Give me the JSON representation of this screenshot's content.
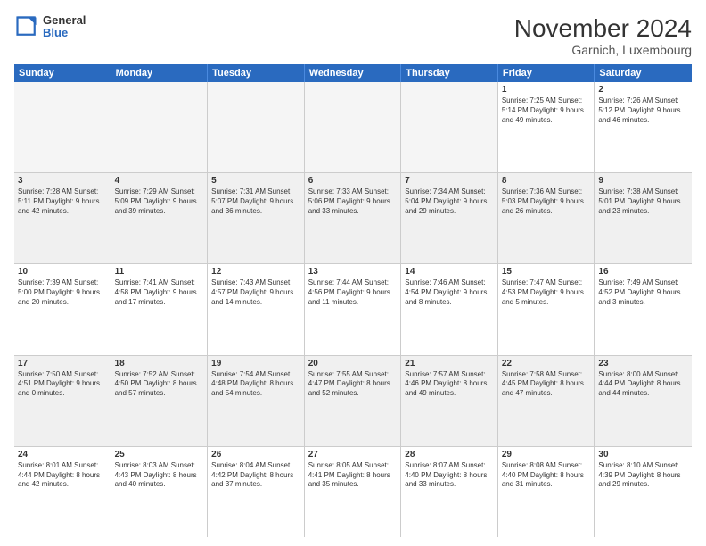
{
  "header": {
    "logo_general": "General",
    "logo_blue": "Blue",
    "title": "November 2024",
    "subtitle": "Garnich, Luxembourg"
  },
  "days": [
    "Sunday",
    "Monday",
    "Tuesday",
    "Wednesday",
    "Thursday",
    "Friday",
    "Saturday"
  ],
  "rows": [
    [
      {
        "day": "",
        "empty": true
      },
      {
        "day": "",
        "empty": true
      },
      {
        "day": "",
        "empty": true
      },
      {
        "day": "",
        "empty": true
      },
      {
        "day": "",
        "empty": true
      },
      {
        "day": "1",
        "info": "Sunrise: 7:25 AM\nSunset: 5:14 PM\nDaylight: 9 hours\nand 49 minutes."
      },
      {
        "day": "2",
        "info": "Sunrise: 7:26 AM\nSunset: 5:12 PM\nDaylight: 9 hours\nand 46 minutes."
      }
    ],
    [
      {
        "day": "3",
        "info": "Sunrise: 7:28 AM\nSunset: 5:11 PM\nDaylight: 9 hours\nand 42 minutes."
      },
      {
        "day": "4",
        "info": "Sunrise: 7:29 AM\nSunset: 5:09 PM\nDaylight: 9 hours\nand 39 minutes."
      },
      {
        "day": "5",
        "info": "Sunrise: 7:31 AM\nSunset: 5:07 PM\nDaylight: 9 hours\nand 36 minutes."
      },
      {
        "day": "6",
        "info": "Sunrise: 7:33 AM\nSunset: 5:06 PM\nDaylight: 9 hours\nand 33 minutes."
      },
      {
        "day": "7",
        "info": "Sunrise: 7:34 AM\nSunset: 5:04 PM\nDaylight: 9 hours\nand 29 minutes."
      },
      {
        "day": "8",
        "info": "Sunrise: 7:36 AM\nSunset: 5:03 PM\nDaylight: 9 hours\nand 26 minutes."
      },
      {
        "day": "9",
        "info": "Sunrise: 7:38 AM\nSunset: 5:01 PM\nDaylight: 9 hours\nand 23 minutes."
      }
    ],
    [
      {
        "day": "10",
        "info": "Sunrise: 7:39 AM\nSunset: 5:00 PM\nDaylight: 9 hours\nand 20 minutes."
      },
      {
        "day": "11",
        "info": "Sunrise: 7:41 AM\nSunset: 4:58 PM\nDaylight: 9 hours\nand 17 minutes."
      },
      {
        "day": "12",
        "info": "Sunrise: 7:43 AM\nSunset: 4:57 PM\nDaylight: 9 hours\nand 14 minutes."
      },
      {
        "day": "13",
        "info": "Sunrise: 7:44 AM\nSunset: 4:56 PM\nDaylight: 9 hours\nand 11 minutes."
      },
      {
        "day": "14",
        "info": "Sunrise: 7:46 AM\nSunset: 4:54 PM\nDaylight: 9 hours\nand 8 minutes."
      },
      {
        "day": "15",
        "info": "Sunrise: 7:47 AM\nSunset: 4:53 PM\nDaylight: 9 hours\nand 5 minutes."
      },
      {
        "day": "16",
        "info": "Sunrise: 7:49 AM\nSunset: 4:52 PM\nDaylight: 9 hours\nand 3 minutes."
      }
    ],
    [
      {
        "day": "17",
        "info": "Sunrise: 7:50 AM\nSunset: 4:51 PM\nDaylight: 9 hours\nand 0 minutes."
      },
      {
        "day": "18",
        "info": "Sunrise: 7:52 AM\nSunset: 4:50 PM\nDaylight: 8 hours\nand 57 minutes."
      },
      {
        "day": "19",
        "info": "Sunrise: 7:54 AM\nSunset: 4:48 PM\nDaylight: 8 hours\nand 54 minutes."
      },
      {
        "day": "20",
        "info": "Sunrise: 7:55 AM\nSunset: 4:47 PM\nDaylight: 8 hours\nand 52 minutes."
      },
      {
        "day": "21",
        "info": "Sunrise: 7:57 AM\nSunset: 4:46 PM\nDaylight: 8 hours\nand 49 minutes."
      },
      {
        "day": "22",
        "info": "Sunrise: 7:58 AM\nSunset: 4:45 PM\nDaylight: 8 hours\nand 47 minutes."
      },
      {
        "day": "23",
        "info": "Sunrise: 8:00 AM\nSunset: 4:44 PM\nDaylight: 8 hours\nand 44 minutes."
      }
    ],
    [
      {
        "day": "24",
        "info": "Sunrise: 8:01 AM\nSunset: 4:44 PM\nDaylight: 8 hours\nand 42 minutes."
      },
      {
        "day": "25",
        "info": "Sunrise: 8:03 AM\nSunset: 4:43 PM\nDaylight: 8 hours\nand 40 minutes."
      },
      {
        "day": "26",
        "info": "Sunrise: 8:04 AM\nSunset: 4:42 PM\nDaylight: 8 hours\nand 37 minutes."
      },
      {
        "day": "27",
        "info": "Sunrise: 8:05 AM\nSunset: 4:41 PM\nDaylight: 8 hours\nand 35 minutes."
      },
      {
        "day": "28",
        "info": "Sunrise: 8:07 AM\nSunset: 4:40 PM\nDaylight: 8 hours\nand 33 minutes."
      },
      {
        "day": "29",
        "info": "Sunrise: 8:08 AM\nSunset: 4:40 PM\nDaylight: 8 hours\nand 31 minutes."
      },
      {
        "day": "30",
        "info": "Sunrise: 8:10 AM\nSunset: 4:39 PM\nDaylight: 8 hours\nand 29 minutes."
      }
    ]
  ]
}
